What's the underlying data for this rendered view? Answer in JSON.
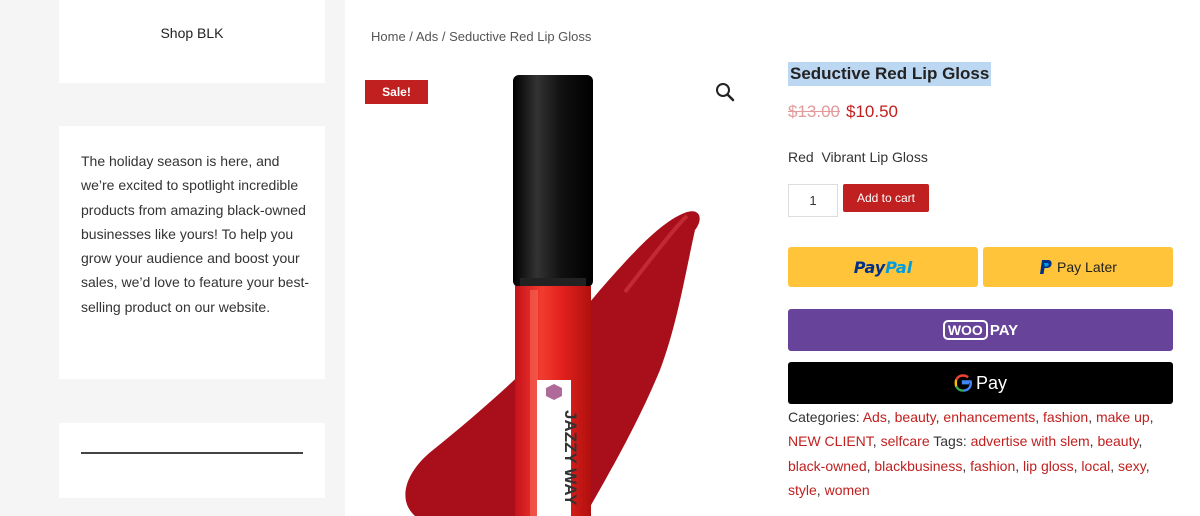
{
  "sidebar": {
    "shop_title": "Shop BLK",
    "promo_text": "The holiday season is here, and we’re excited to spotlight incredible products from amazing black-owned businesses like yours! To help you grow your audience and boost your sales, we’d love to feature your best-selling product on our website."
  },
  "breadcrumb": {
    "home": "Home",
    "sep": " / ",
    "ads": "Ads",
    "current": "Seductive Red Lip Gloss"
  },
  "product": {
    "sale_badge": "Sale!",
    "title": "Seductive Red Lip Gloss",
    "old_price": "$13.00",
    "new_price": "$10.50",
    "short_desc": "Red  Vibrant Lip Gloss",
    "quantity": "1",
    "add_to_cart": "Add to cart",
    "tube_brand": "JAZZY WAY",
    "zoom_icon": "magnifier-icon"
  },
  "payments": {
    "paypal_p1": "Pay",
    "paypal_p2": "Pal",
    "paylater_label": "Pay Later",
    "woo_box": "WOO",
    "woo_pay": "PAY",
    "gpay_label": "Pay"
  },
  "meta": {
    "categories_label": "Categories: ",
    "categories": [
      "Ads",
      "beauty",
      "enhancements",
      "fashion",
      "make up",
      "NEW CLIENT",
      "selfcare"
    ],
    "tags_label": " Tags: ",
    "tags": [
      "advertise with slem",
      "beauty",
      "black-owned",
      "blackbusiness",
      "fashion",
      "lip gloss",
      "local",
      "sexy",
      "style",
      "women"
    ]
  },
  "colors": {
    "accent": "#c0201f",
    "paypal_yellow": "#ffc439",
    "woopay_purple": "#674399",
    "title_highlight": "#bcd7f2"
  }
}
